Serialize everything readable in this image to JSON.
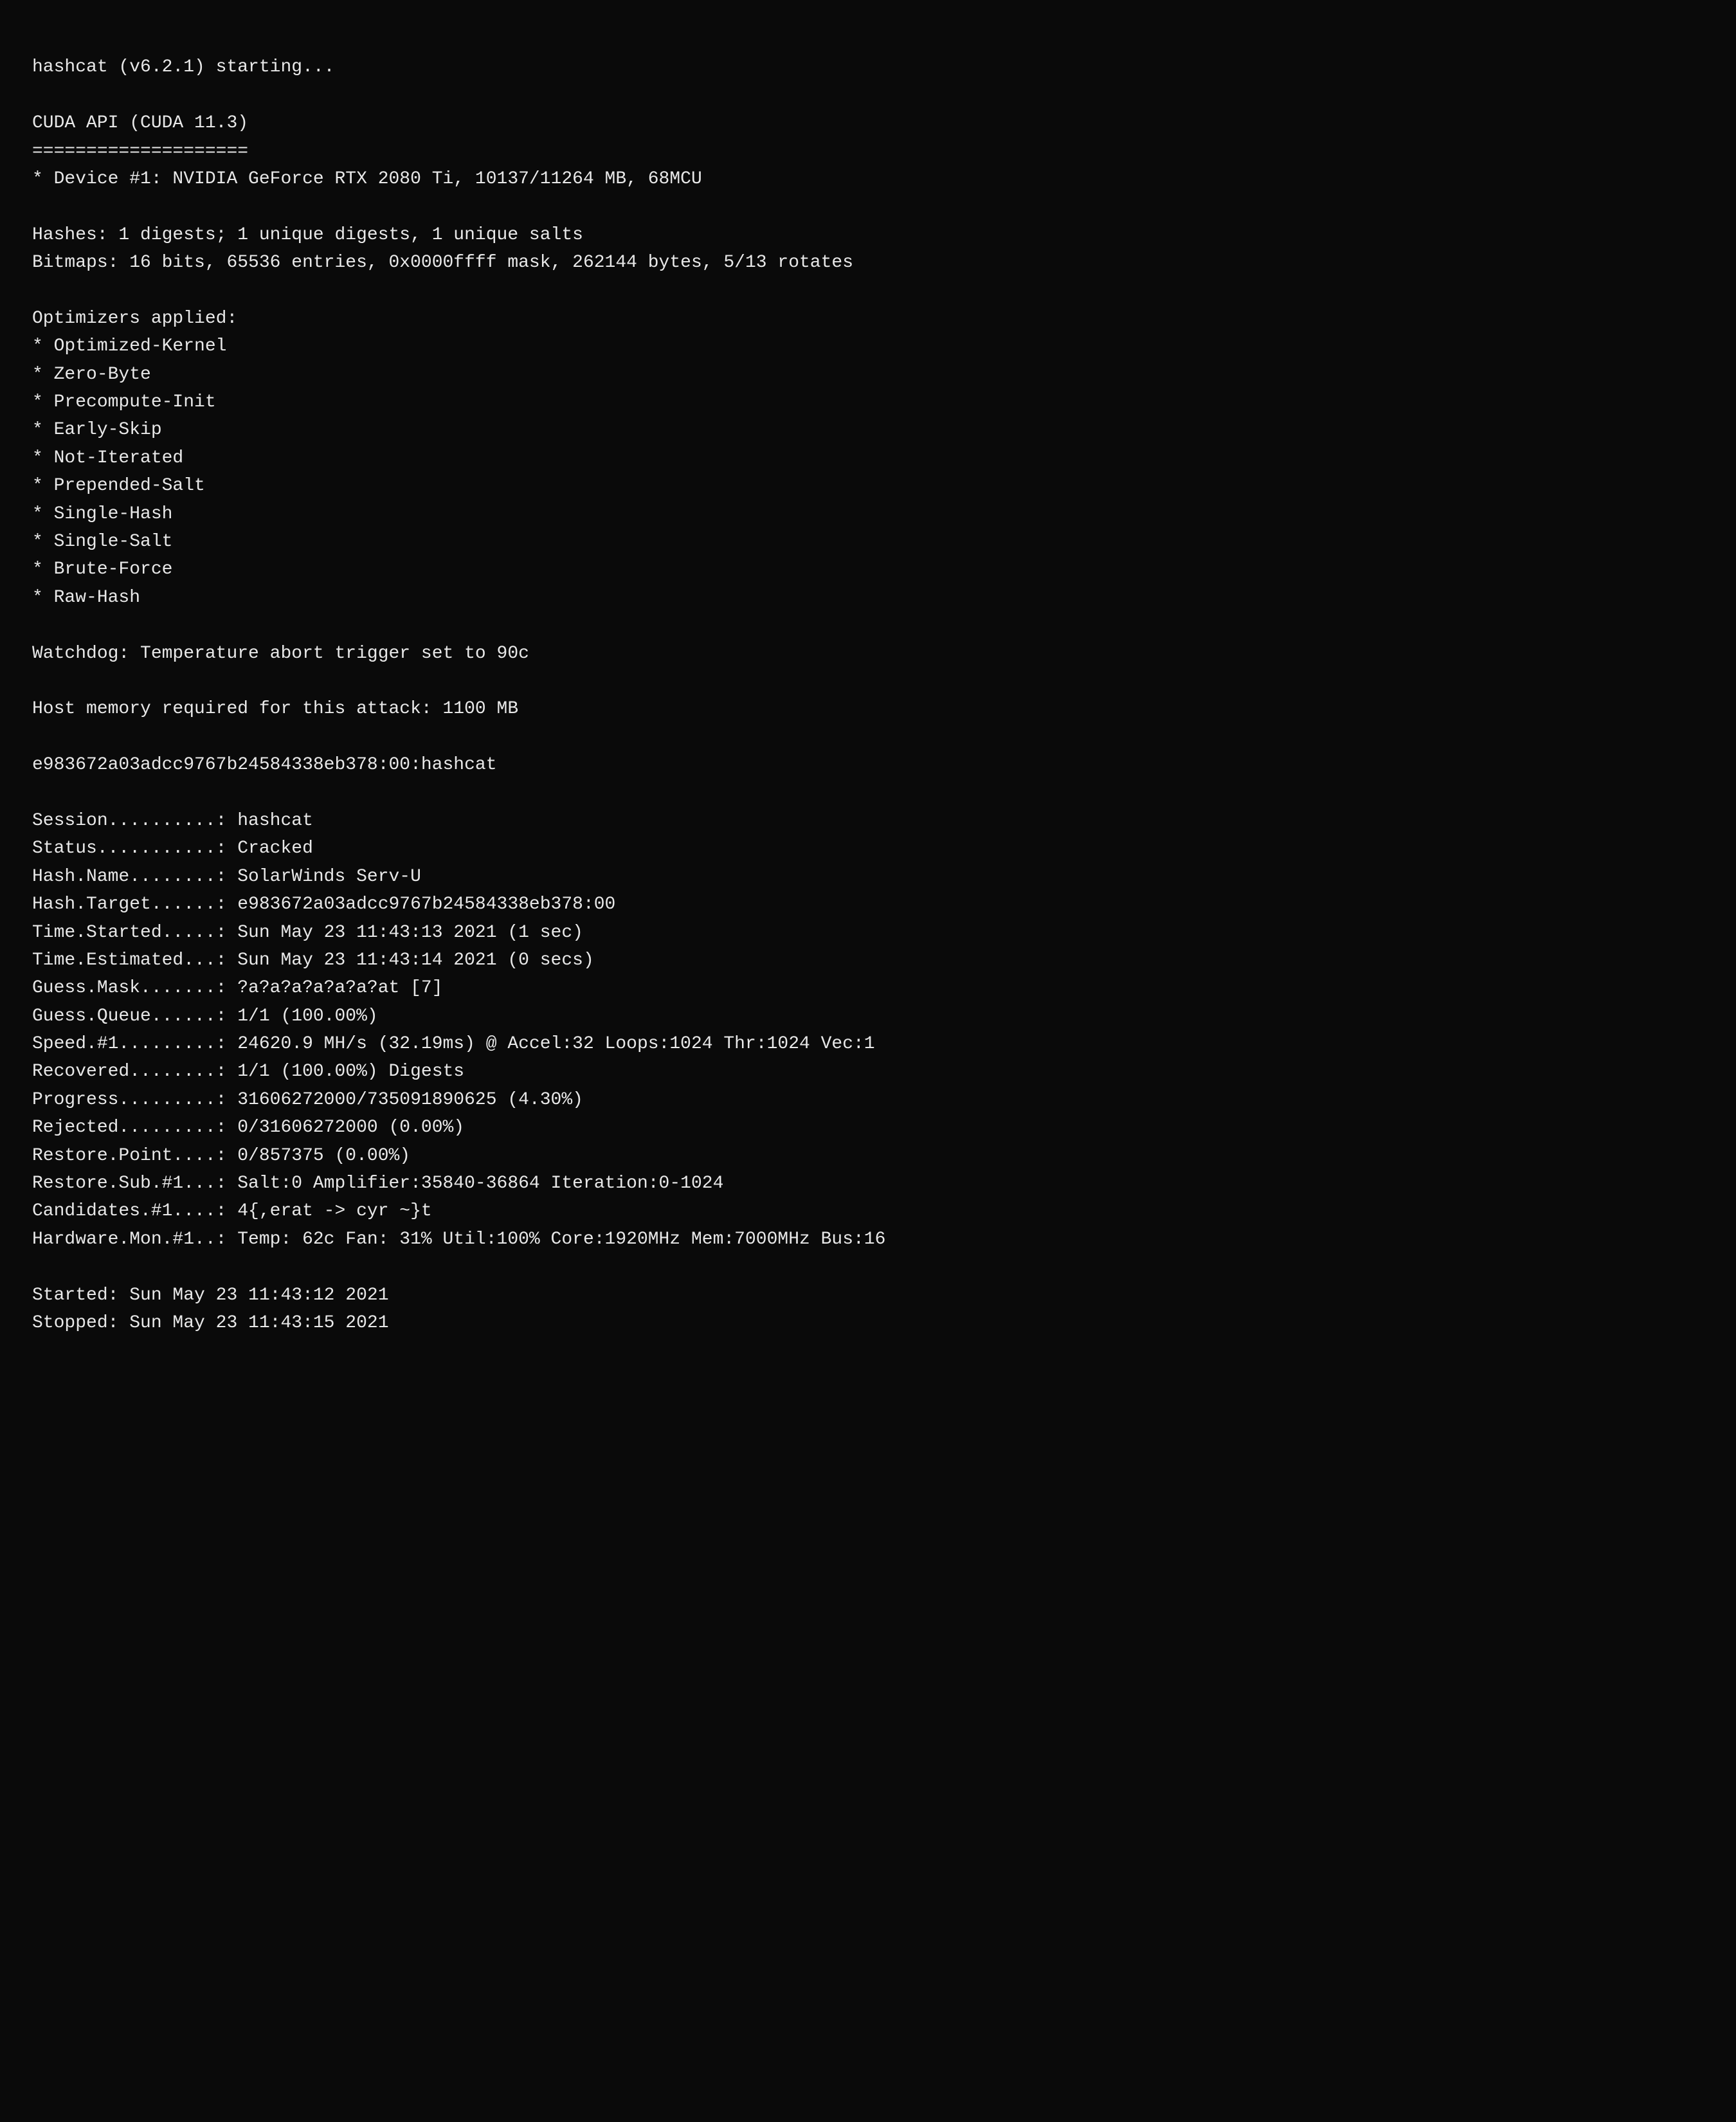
{
  "terminal": {
    "lines": [
      {
        "id": "line-1",
        "text": "hashcat (v6.2.1) starting..."
      },
      {
        "id": "line-empty-1",
        "text": ""
      },
      {
        "id": "line-2",
        "text": "CUDA API (CUDA 11.3)"
      },
      {
        "id": "line-3",
        "text": "===================="
      },
      {
        "id": "line-4",
        "text": "* Device #1: NVIDIA GeForce RTX 2080 Ti, 10137/11264 MB, 68MCU"
      },
      {
        "id": "line-empty-2",
        "text": ""
      },
      {
        "id": "line-5",
        "text": "Hashes: 1 digests; 1 unique digests, 1 unique salts"
      },
      {
        "id": "line-6",
        "text": "Bitmaps: 16 bits, 65536 entries, 0x0000ffff mask, 262144 bytes, 5/13 rotates"
      },
      {
        "id": "line-empty-3",
        "text": ""
      },
      {
        "id": "line-7",
        "text": "Optimizers applied:"
      },
      {
        "id": "line-8",
        "text": "* Optimized-Kernel"
      },
      {
        "id": "line-9",
        "text": "* Zero-Byte"
      },
      {
        "id": "line-10",
        "text": "* Precompute-Init"
      },
      {
        "id": "line-11",
        "text": "* Early-Skip"
      },
      {
        "id": "line-12",
        "text": "* Not-Iterated"
      },
      {
        "id": "line-13",
        "text": "* Prepended-Salt"
      },
      {
        "id": "line-14",
        "text": "* Single-Hash"
      },
      {
        "id": "line-15",
        "text": "* Single-Salt"
      },
      {
        "id": "line-16",
        "text": "* Brute-Force"
      },
      {
        "id": "line-17",
        "text": "* Raw-Hash"
      },
      {
        "id": "line-empty-4",
        "text": ""
      },
      {
        "id": "line-18",
        "text": "Watchdog: Temperature abort trigger set to 90c"
      },
      {
        "id": "line-empty-5",
        "text": ""
      },
      {
        "id": "line-19",
        "text": "Host memory required for this attack: 1100 MB"
      },
      {
        "id": "line-empty-6",
        "text": ""
      },
      {
        "id": "line-20",
        "text": "e983672a03adcc9767b24584338eb378:00:hashcat"
      },
      {
        "id": "line-empty-7",
        "text": ""
      },
      {
        "id": "line-21",
        "text": "Session..........: hashcat"
      },
      {
        "id": "line-22",
        "text": "Status...........: Cracked"
      },
      {
        "id": "line-23",
        "text": "Hash.Name........: SolarWinds Serv-U"
      },
      {
        "id": "line-24",
        "text": "Hash.Target......: e983672a03adcc9767b24584338eb378:00"
      },
      {
        "id": "line-25",
        "text": "Time.Started.....: Sun May 23 11:43:13 2021 (1 sec)"
      },
      {
        "id": "line-26",
        "text": "Time.Estimated...: Sun May 23 11:43:14 2021 (0 secs)"
      },
      {
        "id": "line-27",
        "text": "Guess.Mask.......: ?a?a?a?a?a?a?at [7]"
      },
      {
        "id": "line-28",
        "text": "Guess.Queue......: 1/1 (100.00%)"
      },
      {
        "id": "line-29",
        "text": "Speed.#1.........: 24620.9 MH/s (32.19ms) @ Accel:32 Loops:1024 Thr:1024 Vec:1"
      },
      {
        "id": "line-30",
        "text": "Recovered........: 1/1 (100.00%) Digests"
      },
      {
        "id": "line-31",
        "text": "Progress.........: 31606272000/735091890625 (4.30%)"
      },
      {
        "id": "line-32",
        "text": "Rejected.........: 0/31606272000 (0.00%)"
      },
      {
        "id": "line-33",
        "text": "Restore.Point....: 0/857375 (0.00%)"
      },
      {
        "id": "line-34",
        "text": "Restore.Sub.#1...: Salt:0 Amplifier:35840-36864 Iteration:0-1024"
      },
      {
        "id": "line-35",
        "text": "Candidates.#1....: 4{,erat -> cyr ~}t"
      },
      {
        "id": "line-36",
        "text": "Hardware.Mon.#1..: Temp: 62c Fan: 31% Util:100% Core:1920MHz Mem:7000MHz Bus:16"
      },
      {
        "id": "line-empty-8",
        "text": ""
      },
      {
        "id": "line-37",
        "text": "Started: Sun May 23 11:43:12 2021"
      },
      {
        "id": "line-38",
        "text": "Stopped: Sun May 23 11:43:15 2021"
      }
    ]
  }
}
